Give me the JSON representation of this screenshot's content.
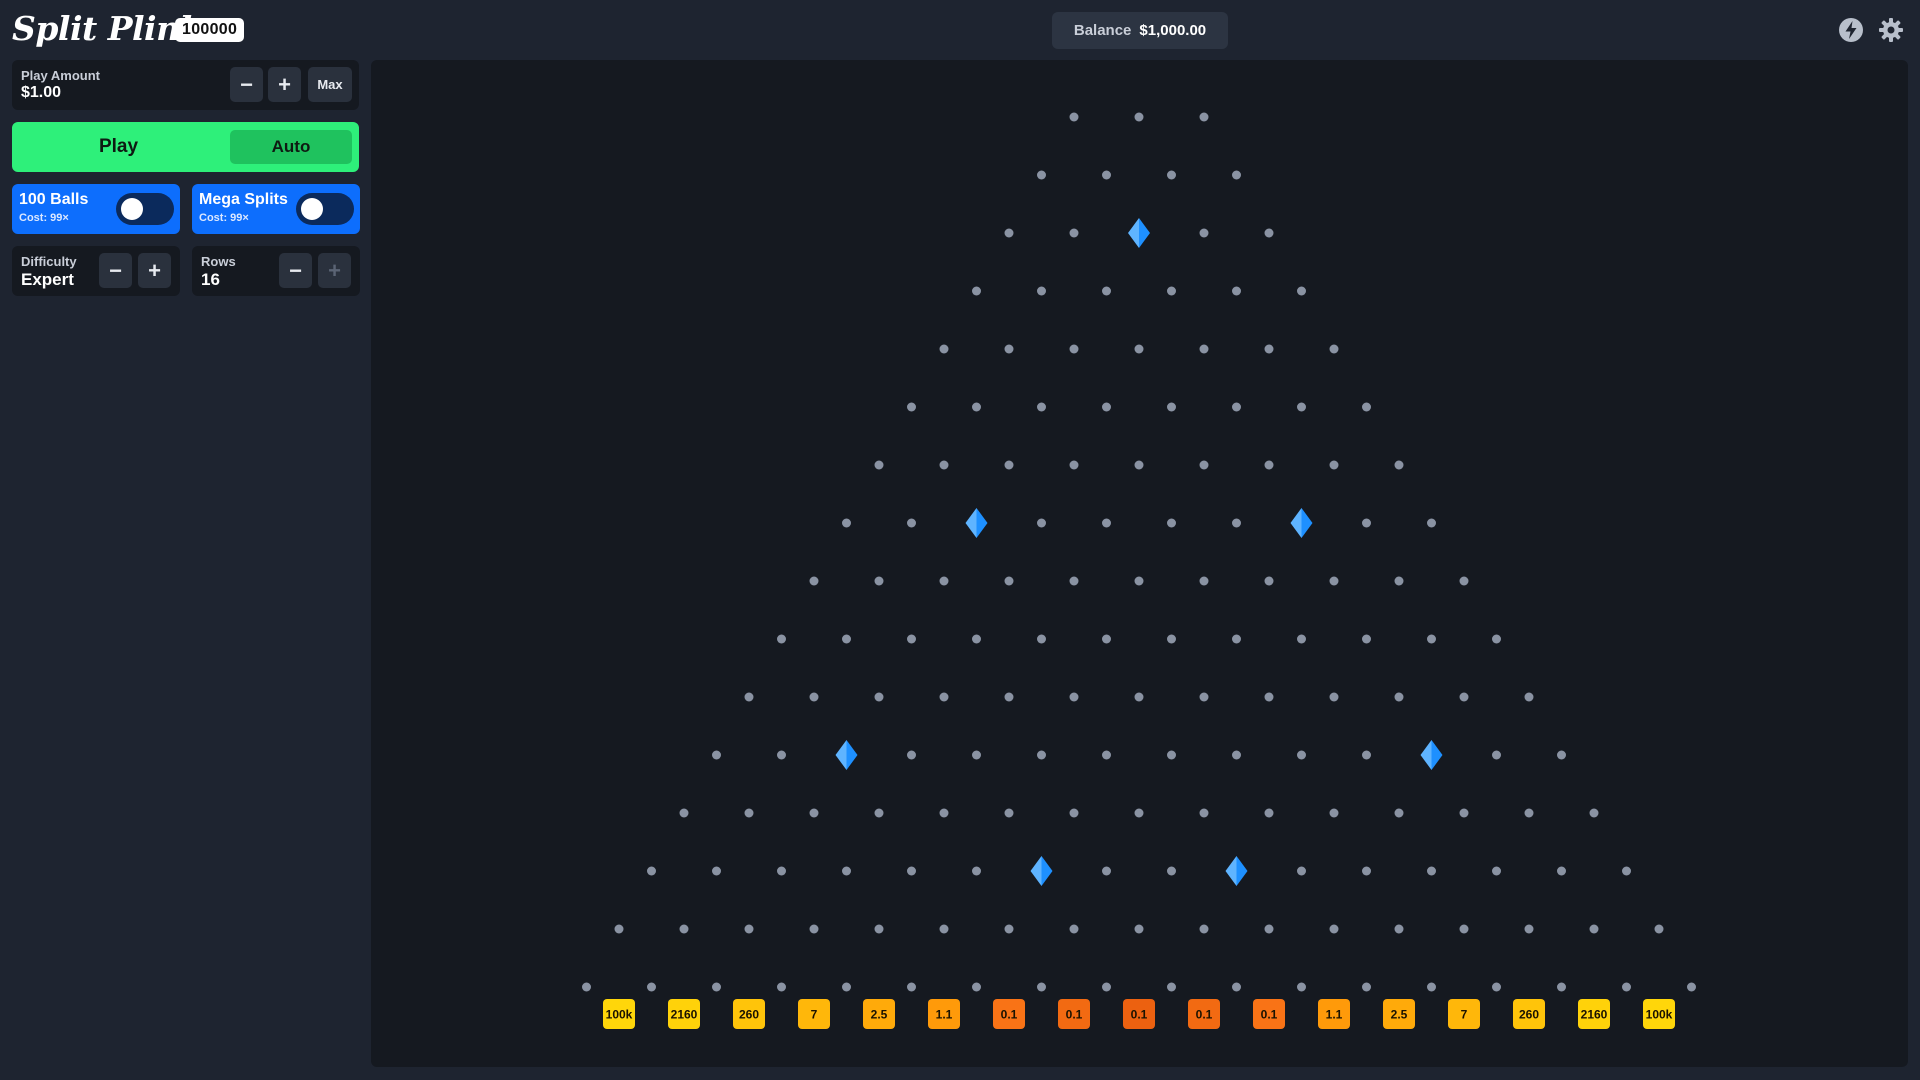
{
  "header": {
    "logo_text": "Split Plinko",
    "logo_badge": "100000",
    "balance_label": "Balance",
    "balance_value": "$1,000.00",
    "icons": [
      "lightning-icon",
      "gear-icon"
    ]
  },
  "controls": {
    "play_amount": {
      "label": "Play Amount",
      "value": "$1.00",
      "minus": "−",
      "plus": "+",
      "max": "Max"
    },
    "play_label": "Play",
    "auto_label": "Auto",
    "balls_toggle": {
      "title": "100 Balls",
      "cost": "Cost: 99×",
      "on": false
    },
    "mega_toggle": {
      "title": "Mega Splits",
      "cost": "Cost: 99×",
      "on": false
    },
    "difficulty": {
      "label": "Difficulty",
      "value": "Expert",
      "minus": "−",
      "plus": "+"
    },
    "rows": {
      "label": "Rows",
      "value": "16",
      "minus": "−",
      "plus": "+"
    }
  },
  "board": {
    "rows": 16,
    "peg_color": "#8a93a3",
    "splitter_color": "#1e90ff",
    "splitters": [
      [
        2,
        2
      ],
      [
        7,
        2
      ],
      [
        7,
        7
      ],
      [
        11,
        2
      ],
      [
        11,
        11
      ],
      [
        13,
        6
      ],
      [
        13,
        9
      ]
    ],
    "multipliers": [
      "100k",
      "2160",
      "260",
      "7",
      "2.5",
      "1.1",
      "0.1",
      "0.1",
      "0.1",
      "0.1",
      "0.1",
      "1.1",
      "2.5",
      "7",
      "260",
      "2160",
      "100k"
    ],
    "slot_colors": [
      "#ffd60a",
      "#ffd20a",
      "#ffc40a",
      "#ffb70a",
      "#ffaa0a",
      "#ff9a0a",
      "#f97316",
      "#f26a12",
      "#ec6110",
      "#f26a12",
      "#f97316",
      "#ff9a0a",
      "#ffaa0a",
      "#ffb70a",
      "#ffc40a",
      "#ffd20a",
      "#ffd60a"
    ]
  }
}
